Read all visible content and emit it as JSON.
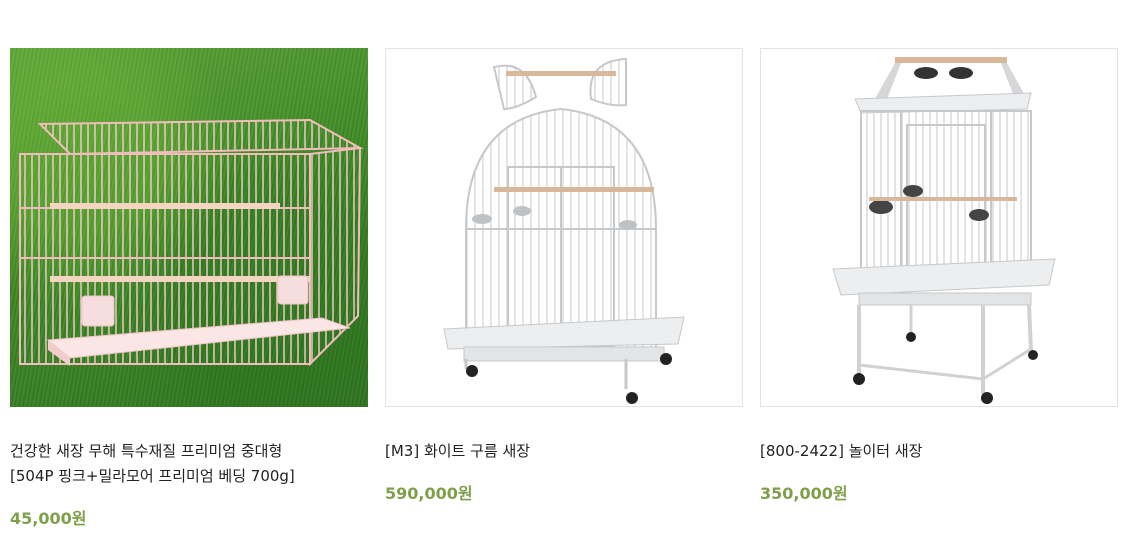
{
  "products": [
    {
      "name_lines": [
        "건강한 새장 무해 특수재질 프리미엄 중대형",
        "[504P 핑크+밀라모어 프리미엄 베딩 700g]"
      ],
      "price": "45,000원",
      "image": "pink-bird-cage-on-grass"
    },
    {
      "name_lines": [
        "[M3] 화이트 구름 새장"
      ],
      "price": "590,000원",
      "image": "white-dome-parrot-cage"
    },
    {
      "name_lines": [
        "[800-2422] 놀이터 새장"
      ],
      "price": "350,000원",
      "image": "white-playtop-parrot-cage"
    }
  ],
  "colors": {
    "price": "#7f9f4a",
    "text": "#222222",
    "border": "#e3e3e3"
  }
}
